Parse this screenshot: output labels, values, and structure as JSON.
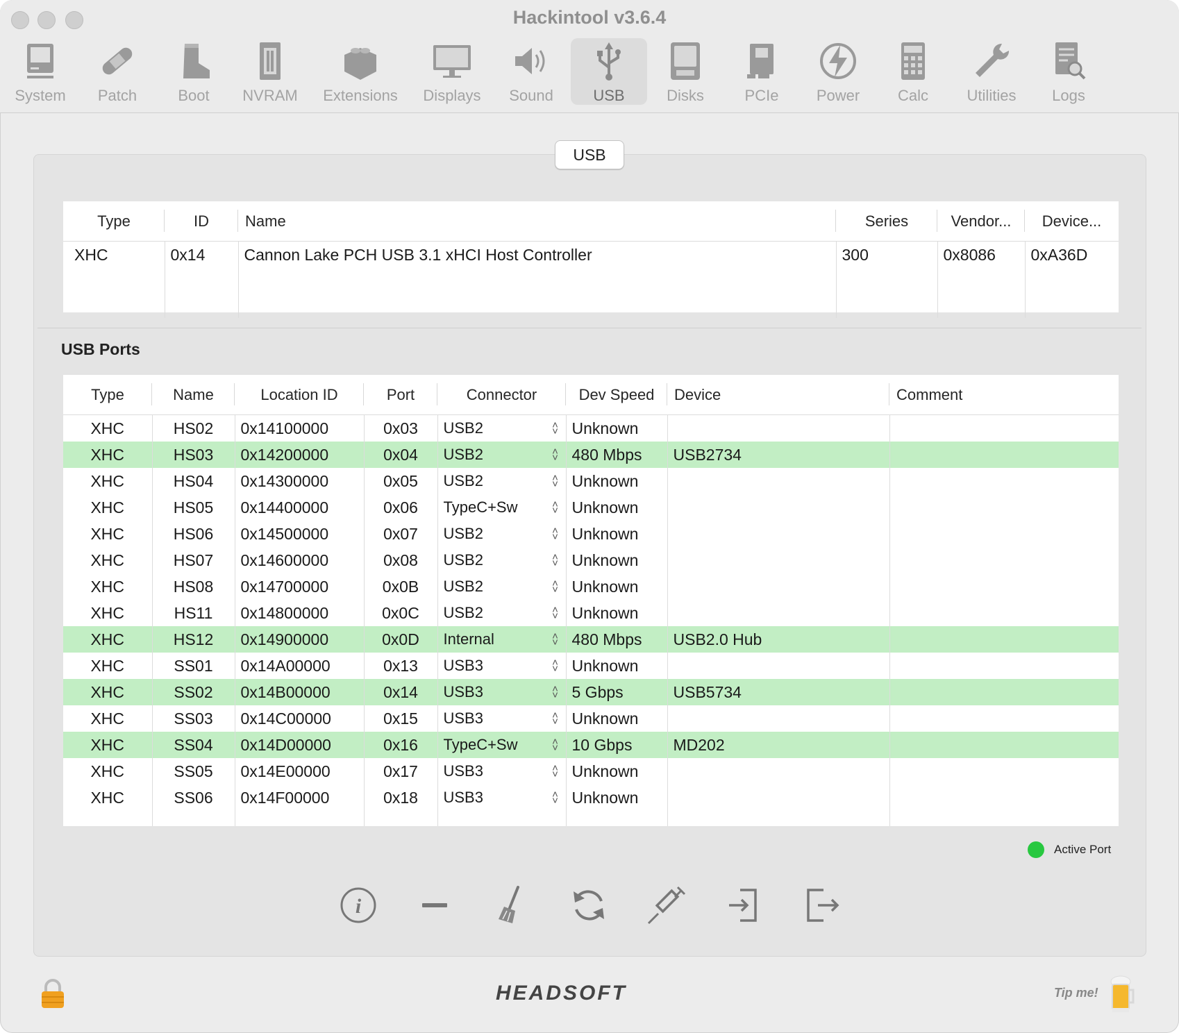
{
  "window": {
    "title": "Hackintool v3.6.4"
  },
  "toolbar": {
    "items": [
      {
        "label": "System",
        "icon": "computer-icon"
      },
      {
        "label": "Patch",
        "icon": "bandage-icon"
      },
      {
        "label": "Boot",
        "icon": "boot-icon"
      },
      {
        "label": "NVRAM",
        "icon": "memory-icon"
      },
      {
        "label": "Extensions",
        "icon": "lego-brick-icon"
      },
      {
        "label": "Displays",
        "icon": "monitor-icon"
      },
      {
        "label": "Sound",
        "icon": "speaker-icon"
      },
      {
        "label": "USB",
        "icon": "usb-icon",
        "selected": true
      },
      {
        "label": "Disks",
        "icon": "disk-icon"
      },
      {
        "label": "PCIe",
        "icon": "pcie-card-icon"
      },
      {
        "label": "Power",
        "icon": "power-bolt-icon"
      },
      {
        "label": "Calc",
        "icon": "calculator-icon"
      },
      {
        "label": "Utilities",
        "icon": "wrench-icon"
      },
      {
        "label": "Logs",
        "icon": "log-search-icon"
      }
    ]
  },
  "usb_tab": {
    "label": "USB"
  },
  "controllers": {
    "headers": [
      "Type",
      "ID",
      "Name",
      "Series",
      "Vendor...",
      "Device..."
    ],
    "rows": [
      [
        "XHC",
        "0x14",
        "Cannon Lake PCH USB 3.1 xHCI Host Controller",
        "300",
        "0x8086",
        "0xA36D"
      ]
    ]
  },
  "ports": {
    "title": "USB Ports",
    "headers": [
      "Type",
      "Name",
      "Location ID",
      "Port",
      "Connector",
      "Dev Speed",
      "Device",
      "Comment"
    ],
    "rows": [
      {
        "type": "XHC",
        "name": "HS02",
        "location": "0x14100000",
        "port": "0x03",
        "connector": "USB2",
        "speed": "Unknown",
        "device": "",
        "comment": "",
        "active": false
      },
      {
        "type": "XHC",
        "name": "HS03",
        "location": "0x14200000",
        "port": "0x04",
        "connector": "USB2",
        "speed": "480 Mbps",
        "device": "USB2734",
        "comment": "",
        "active": true
      },
      {
        "type": "XHC",
        "name": "HS04",
        "location": "0x14300000",
        "port": "0x05",
        "connector": "USB2",
        "speed": "Unknown",
        "device": "",
        "comment": "",
        "active": false
      },
      {
        "type": "XHC",
        "name": "HS05",
        "location": "0x14400000",
        "port": "0x06",
        "connector": "TypeC+Sw",
        "speed": "Unknown",
        "device": "",
        "comment": "",
        "active": false
      },
      {
        "type": "XHC",
        "name": "HS06",
        "location": "0x14500000",
        "port": "0x07",
        "connector": "USB2",
        "speed": "Unknown",
        "device": "",
        "comment": "",
        "active": false
      },
      {
        "type": "XHC",
        "name": "HS07",
        "location": "0x14600000",
        "port": "0x08",
        "connector": "USB2",
        "speed": "Unknown",
        "device": "",
        "comment": "",
        "active": false
      },
      {
        "type": "XHC",
        "name": "HS08",
        "location": "0x14700000",
        "port": "0x0B",
        "connector": "USB2",
        "speed": "Unknown",
        "device": "",
        "comment": "",
        "active": false
      },
      {
        "type": "XHC",
        "name": "HS11",
        "location": "0x14800000",
        "port": "0x0C",
        "connector": "USB2",
        "speed": "Unknown",
        "device": "",
        "comment": "",
        "active": false
      },
      {
        "type": "XHC",
        "name": "HS12",
        "location": "0x14900000",
        "port": "0x0D",
        "connector": "Internal",
        "speed": "480 Mbps",
        "device": "USB2.0 Hub",
        "comment": "",
        "active": true
      },
      {
        "type": "XHC",
        "name": "SS01",
        "location": "0x14A00000",
        "port": "0x13",
        "connector": "USB3",
        "speed": "Unknown",
        "device": "",
        "comment": "",
        "active": false
      },
      {
        "type": "XHC",
        "name": "SS02",
        "location": "0x14B00000",
        "port": "0x14",
        "connector": "USB3",
        "speed": "5 Gbps",
        "device": "USB5734",
        "comment": "",
        "active": true
      },
      {
        "type": "XHC",
        "name": "SS03",
        "location": "0x14C00000",
        "port": "0x15",
        "connector": "USB3",
        "speed": "Unknown",
        "device": "",
        "comment": "",
        "active": false
      },
      {
        "type": "XHC",
        "name": "SS04",
        "location": "0x14D00000",
        "port": "0x16",
        "connector": "TypeC+Sw",
        "speed": "10 Gbps",
        "device": "MD202",
        "comment": "",
        "active": true
      },
      {
        "type": "XHC",
        "name": "SS05",
        "location": "0x14E00000",
        "port": "0x17",
        "connector": "USB3",
        "speed": "Unknown",
        "device": "",
        "comment": "",
        "active": false
      },
      {
        "type": "XHC",
        "name": "SS06",
        "location": "0x14F00000",
        "port": "0x18",
        "connector": "USB3",
        "speed": "Unknown",
        "device": "",
        "comment": "",
        "active": false
      }
    ]
  },
  "legend": {
    "label": "Active Port",
    "color": "#28c840"
  },
  "actions": [
    "info-icon",
    "remove-icon",
    "broom-icon",
    "refresh-icon",
    "syringe-icon",
    "import-icon",
    "export-icon"
  ],
  "footer": {
    "brand": "HEADSOFT",
    "tip": "Tip me!"
  },
  "colors": {
    "active_row": "#c2eec4",
    "window_bg": "#ececec"
  }
}
